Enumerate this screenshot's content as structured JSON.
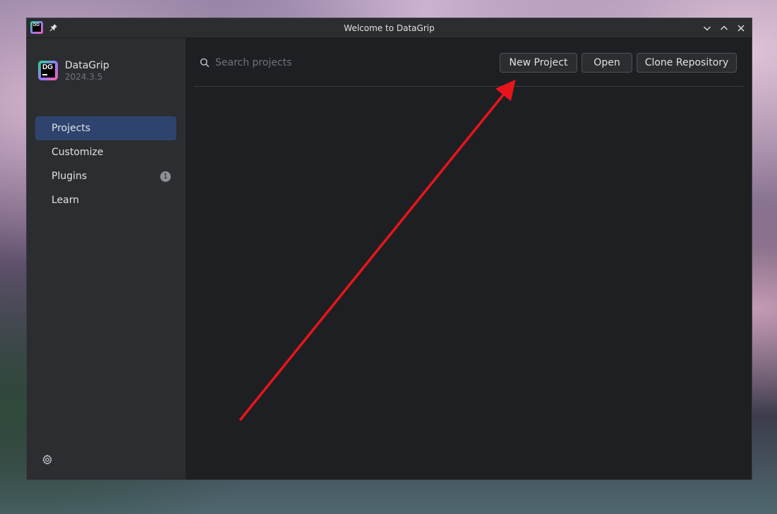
{
  "window": {
    "title": "Welcome to DataGrip"
  },
  "titlebar": {
    "app_icon": "datagrip-icon",
    "app_icon_letters": "DG",
    "pin_icon": "pin-icon",
    "controls": [
      "minimize-icon",
      "maximize-icon",
      "close-icon"
    ]
  },
  "sidebar": {
    "brand": {
      "name": "DataGrip",
      "version": "2024.3.5",
      "logo_letters": "DG"
    },
    "items": [
      {
        "label": "Projects",
        "active": true
      },
      {
        "label": "Customize",
        "active": false
      },
      {
        "label": "Plugins",
        "active": false,
        "badge": "1"
      },
      {
        "label": "Learn",
        "active": false
      }
    ],
    "settings_icon": "gear-icon"
  },
  "main": {
    "search": {
      "placeholder": "Search projects",
      "value": ""
    },
    "buttons": {
      "new_project": "New Project",
      "open": "Open",
      "clone_repository": "Clone Repository"
    }
  },
  "annotation": {
    "color": "#e8141b"
  },
  "colors": {
    "accent": "#2e436e",
    "sidebar_bg": "#2b2d30",
    "main_bg": "#1e1f22"
  }
}
